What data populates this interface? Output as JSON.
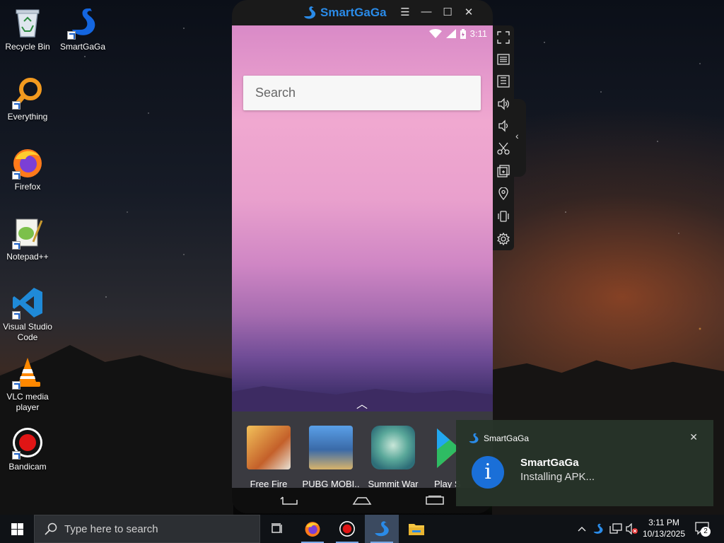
{
  "desktop": {
    "icons": [
      {
        "label": "Recycle Bin",
        "icon": "recycle-bin-icon"
      },
      {
        "label": "SmartGaGa",
        "icon": "smartgaga-swan-icon"
      },
      {
        "label": "Everything",
        "icon": "magnifier-icon"
      },
      {
        "label": "Firefox",
        "icon": "firefox-icon"
      },
      {
        "label": "Notepad++",
        "icon": "notepad-plus-plus-icon"
      },
      {
        "label": "Visual Studio Code",
        "icon": "vscode-icon"
      },
      {
        "label": "VLC media player",
        "icon": "vlc-cone-icon"
      },
      {
        "label": "Bandicam",
        "icon": "record-icon"
      }
    ]
  },
  "emulator": {
    "title": "SmartGaGa",
    "status_time": "3:11",
    "search_placeholder": "Search",
    "dock_apps": [
      {
        "label": "Free Fire"
      },
      {
        "label": "PUBG MOBI.."
      },
      {
        "label": "Summit War"
      },
      {
        "label": "Play S"
      }
    ],
    "side_tools": [
      "fullscreen-icon",
      "keyboard-icon",
      "apk-install-icon",
      "volume-up-icon",
      "volume-down-icon",
      "scissors-icon",
      "multi-instance-icon",
      "location-icon",
      "shake-icon",
      "settings-icon"
    ]
  },
  "notification": {
    "app": "SmartGaGa",
    "title": "SmartGaGa",
    "message": "Installing APK..."
  },
  "taskbar": {
    "search_placeholder": "Type here to search",
    "time": "3:11 PM",
    "date": "10/13/2025",
    "notification_count": "2"
  },
  "colors": {
    "accent": "#2a8be8",
    "taskbar": "#0f1216",
    "toast": "#28342a",
    "info_blue": "#1a6fd8"
  }
}
